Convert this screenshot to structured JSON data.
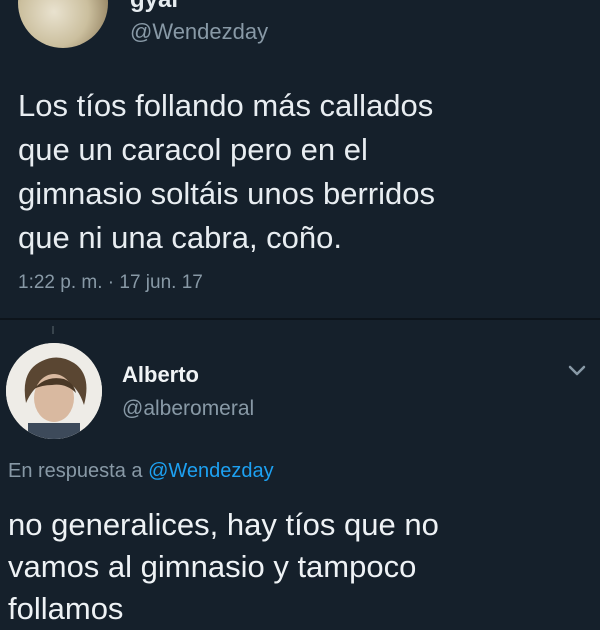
{
  "tweet": {
    "author_name": "gyal",
    "author_handle": "@Wendezday",
    "text": "Los tíos follando más callados\nque un caracol pero en el\ngimnasio soltáis unos berridos\nque ni una cabra, coño.",
    "timestamp": "1:22 p. m. · 17 jun. 17"
  },
  "reply": {
    "author_name": "Alberto",
    "author_handle": "@alberomeral",
    "in_reply_to_label": "En respuesta a",
    "in_reply_to_handle": "@Wendezday",
    "text": "no generalices, hay tíos que no\nvamos al gimnasio y tampoco\nfollamos"
  },
  "colors": {
    "background": "#15202b",
    "secondary_text": "#8899a6",
    "link": "#1da1f2"
  },
  "icons": {
    "menu": "chevron-down-icon"
  }
}
